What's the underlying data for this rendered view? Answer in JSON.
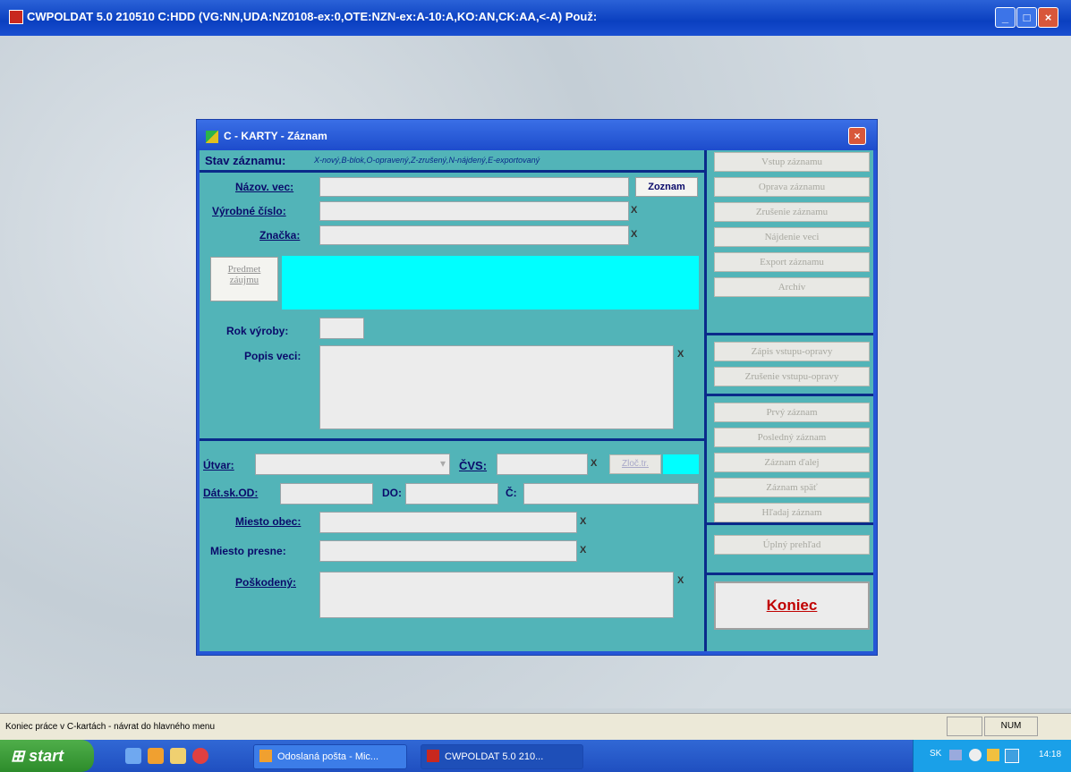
{
  "window": {
    "title": "CWPOLDAT 5.0 210510 C:HDD (VG:NN,UDA:NZ0108-ex:0,OTE:NZN-ex:A-10:A,KO:AN,CK:AA,<-A) Použ:",
    "minimize": "_",
    "maximize": "□",
    "close": "×"
  },
  "dialog": {
    "title": "C - KARTY - Záznam",
    "close": "×",
    "stav_label": "Stav záznamu:",
    "stav_hint": "X-nový,B-blok,O-opravený,Z-zrušený,N-nájdený,E-exportovaný",
    "nazov_label": "Názov. vec:",
    "zoznam_btn": "Zoznam",
    "vyrobne_label": "Výrobné číslo:",
    "znacka_label": "Značka:",
    "predmet_btn_1": "Predmet",
    "predmet_btn_2": "záujmu",
    "rok_label": "Rok výroby:",
    "popis_label": "Popis veci:",
    "utvar_label": "Útvar:",
    "cvs_label": "ČVS:",
    "zloc_btn": "Zloč.tr.",
    "datsk_label": "Dát.sk.OD:",
    "do_label": "DO:",
    "c_label": "Č:",
    "miesto_obec_label": "Miesto obec:",
    "miesto_presne_label": "Miesto presne:",
    "poskodeny_label": "Poškodený:",
    "x_mark": "X",
    "dropdown_arrow": "▾"
  },
  "buttons": {
    "group1": [
      "Vstup záznamu",
      "Oprava záznamu",
      "Zrušenie záznamu",
      "Nájdenie veci",
      "Export záznamu",
      "Archív"
    ],
    "group2": [
      "Zápis vstupu-opravy",
      "Zrušenie vstupu-opravy"
    ],
    "group3": [
      "Prvý záznam",
      "Posledný záznam",
      "Záznam ďalej",
      "Záznam späť",
      "Hľadaj záznam"
    ],
    "group4": [
      "Úplný prehľad"
    ],
    "koniec": "Koniec"
  },
  "statusbar": {
    "message": "Koniec práce v C-kartách - návrat do hlavného menu",
    "num": "NUM"
  },
  "taskbar": {
    "start": "start",
    "items": [
      "Odoslaná pošta - Mic...",
      "CWPOLDAT 5.0 210..."
    ],
    "clock": "14:18",
    "lang": "SK"
  },
  "colors": {
    "form_bg": "#52b4b8",
    "predmet_area": "#00ffff",
    "koniec_text": "#c00000"
  }
}
